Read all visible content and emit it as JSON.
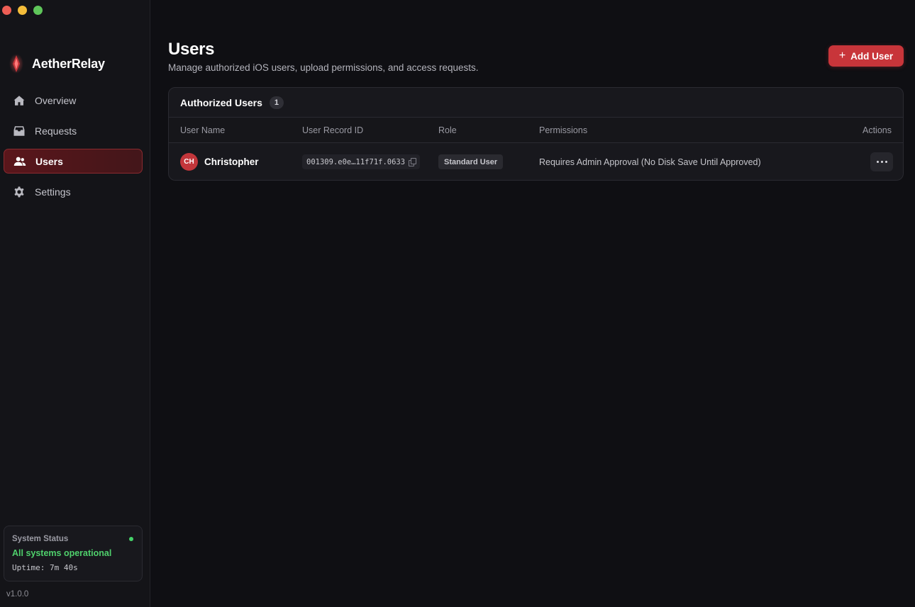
{
  "app": {
    "name": "AetherRelay",
    "version": "v1.0.0"
  },
  "sidebar": {
    "items": [
      {
        "label": "Overview",
        "icon": "home-icon",
        "active": false
      },
      {
        "label": "Requests",
        "icon": "tray-icon",
        "active": false
      },
      {
        "label": "Users",
        "icon": "users-icon",
        "active": true
      },
      {
        "label": "Settings",
        "icon": "gear-icon",
        "active": false
      }
    ],
    "status": {
      "title": "System Status",
      "text": "All systems operational",
      "uptime": "Uptime: 7m 40s",
      "color": "#45d36a"
    }
  },
  "header": {
    "title": "Users",
    "subtitle": "Manage authorized iOS users, upload permissions, and access requests.",
    "add_button_label": "Add User",
    "accent": "#c8353a"
  },
  "users_table": {
    "title": "Authorized Users",
    "count": "1",
    "columns": [
      "User Name",
      "User Record ID",
      "Role",
      "Permissions",
      "Actions"
    ],
    "rows": [
      {
        "initials": "CH",
        "name": "Christopher",
        "record_id": "001309.e0e…11f71f.0633",
        "role": "Standard User",
        "permissions": "Requires Admin Approval (No Disk Save Until Approved)"
      }
    ]
  }
}
